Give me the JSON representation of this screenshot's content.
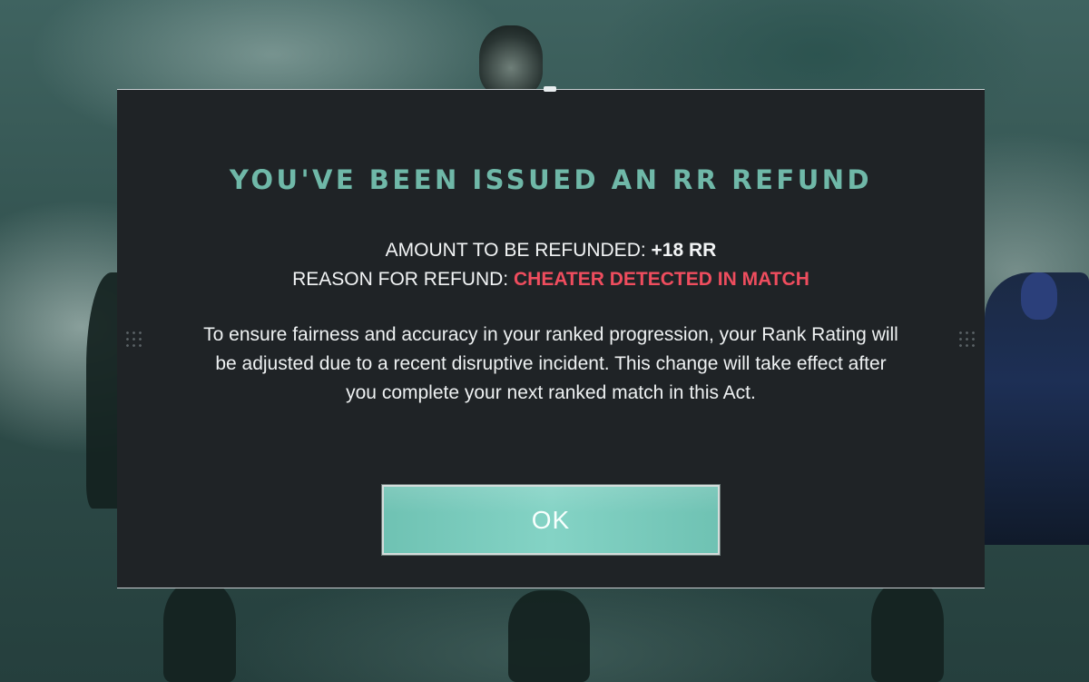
{
  "dialog": {
    "title": "YOU'VE BEEN ISSUED AN RR REFUND",
    "amount_label": "AMOUNT TO BE REFUNDED: ",
    "amount_value": "+18 RR",
    "reason_label": "REASON FOR REFUND: ",
    "reason_value": "CHEATER DETECTED IN MATCH",
    "description": "To ensure fairness and accuracy in your ranked progression, your Rank Rating will be adjusted due to a recent disruptive incident. This change will take effect after you complete your next ranked match in this Act.",
    "ok_label": "OK"
  },
  "colors": {
    "title": "#6fb8a8",
    "reason_value": "#ef4d5e",
    "button": "#7ccbbd",
    "panel": "#1f2326"
  }
}
